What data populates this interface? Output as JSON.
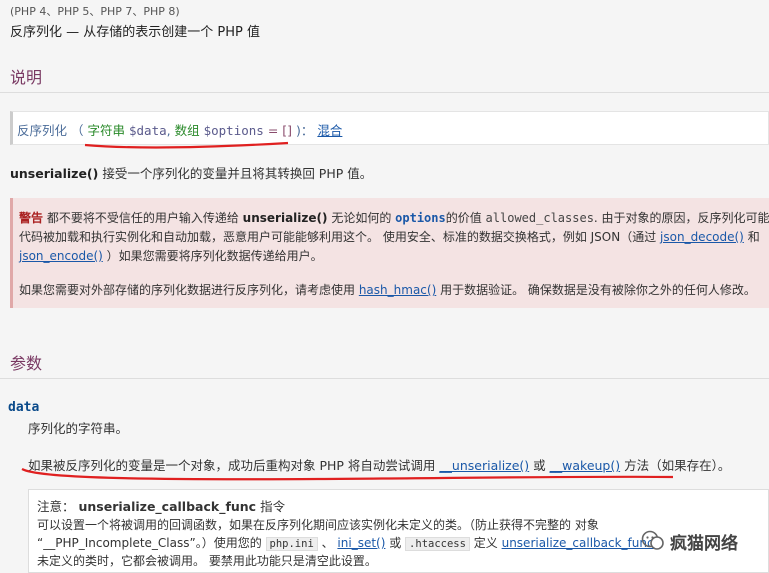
{
  "header": {
    "versions": "(PHP 4、PHP 5、PHP 7、PHP 8)",
    "summary": "反序列化 — 从存储的表示创建一个 PHP 值"
  },
  "sections": {
    "description_title": "说明",
    "parameters_title": "参数"
  },
  "synopsis": {
    "func": "反序列化",
    "open": "（",
    "type1": "字符串",
    "var1": "$data",
    "comma": ",",
    "type2": "数组",
    "var2": "$options",
    "default": "= []",
    "close": ")：",
    "return_type": "混合"
  },
  "description": {
    "func": "unserialize()",
    "text": " 接受一个序列化的变量并且将其转换回 PHP 值。"
  },
  "warning": {
    "label": "警告",
    "l1_a": "都不要将不受信任的用户输入传递给 ",
    "l1_func": "unserialize()",
    "l1_b": " 无论如何的 ",
    "l1_opt": "options",
    "l1_c": "的价值 ",
    "l1_mono": "allowed_classes",
    "l1_d": ". 由于对象的原因，反序列化可能导致",
    "l2_a": "代码被加载和执行实例化和自动加载，恶意用户可能能够利用这个。 使用安全、标准的数据交换格式，例如 JSON（通过 ",
    "l2_link": "json_decode()",
    "l2_b": " 和",
    "l3_link": "json_encode()",
    "l3_a": " ）如果您需要将序列化数据传递给用户。",
    "l4_a": "如果您需要对外部存储的序列化数据进行反序列化，请考虑使用 ",
    "l4_link": "hash_hmac()",
    "l4_b": " 用于数据验证。 确保数据是没有被除你之外的任何人修改。"
  },
  "parameter": {
    "name": "data",
    "desc": "序列化的字符串。",
    "note_a": "如果被反序列化的变量是一个对象，成功后重构对象 PHP 将自动尝试调用 ",
    "note_link1": "__unserialize()",
    "note_b": " 或 ",
    "note_link2": "__wakeup()",
    "note_c": " 方法（如果存在）。"
  },
  "note": {
    "label": "注意：",
    "title": "unserialize_callback_func",
    "title_suffix": " 指令",
    "l1": "可以设置一个将被调用的回调函数，如果在反序列化期间应该实例化未定义的类。（防止获得不完整的 对象",
    "l2_a": "“__PHP_Incomplete_Class”。）使用您的 ",
    "l2_chip1": "php.ini",
    "l2_b": " 、 ",
    "l2_link1": "ini_set()",
    "l2_c": " 或 ",
    "l2_chip2": ".htaccess",
    "l2_d": " 定义 ",
    "l2_link2": "unserialize_callback_func",
    "l2_e": "。",
    "l3": "未定义的类时，它都会被调用。 要禁用此功能只是清空此设置。"
  },
  "watermark": {
    "text": "疯猫网络"
  },
  "colors": {
    "heading": "#793862",
    "link": "#1a58a8",
    "warning_bg": "#f4e3e3",
    "annotation_red": "#e02020"
  }
}
